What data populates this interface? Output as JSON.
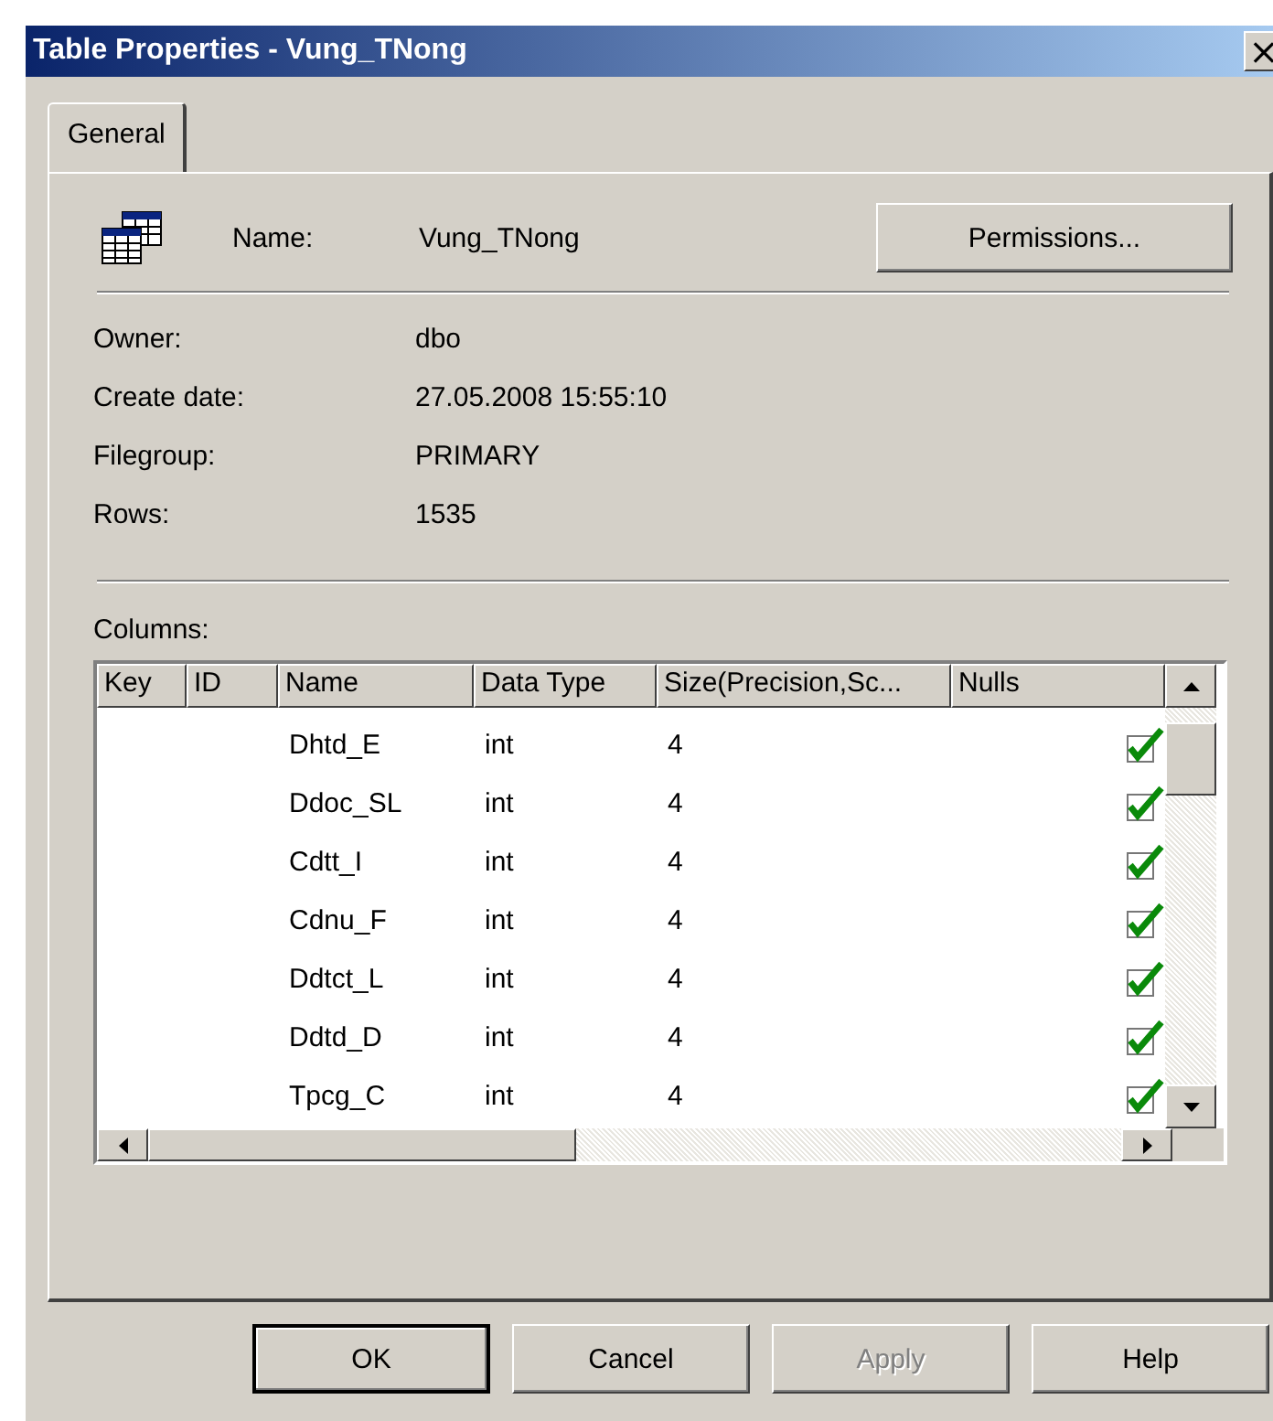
{
  "window": {
    "title": "Table Properties - Vung_TNong",
    "close": "×"
  },
  "tabs": [
    {
      "label": "General",
      "selected": true
    }
  ],
  "name": {
    "label": "Name:",
    "value": "Vung_TNong"
  },
  "permissions_button": "Permissions...",
  "properties": [
    {
      "label": "Owner:",
      "value": "dbo"
    },
    {
      "label": "Create date:",
      "value": "27.05.2008 15:55:10"
    },
    {
      "label": "Filegroup:",
      "value": "PRIMARY"
    },
    {
      "label": "Rows:",
      "value": "1535"
    }
  ],
  "columns_label": "Columns:",
  "table": {
    "columns": [
      "Key",
      "ID",
      "Name",
      "Data Type",
      "Size(Precision,Sc...",
      "Nulls"
    ],
    "rows": [
      {
        "name": "Dhtd_E",
        "type": "int",
        "size": "4",
        "nulls": true
      },
      {
        "name": "Ddoc_SL",
        "type": "int",
        "size": "4",
        "nulls": true
      },
      {
        "name": "Cdtt_I",
        "type": "int",
        "size": "4",
        "nulls": true
      },
      {
        "name": "Cdnu_F",
        "type": "int",
        "size": "4",
        "nulls": true
      },
      {
        "name": "Ddtct_L",
        "type": "int",
        "size": "4",
        "nulls": true
      },
      {
        "name": "Ddtd_D",
        "type": "int",
        "size": "4",
        "nulls": true
      },
      {
        "name": "Tpcg_C",
        "type": "int",
        "size": "4",
        "nulls": true
      }
    ]
  },
  "buttons": [
    {
      "label": "OK",
      "default": true,
      "disabled": false
    },
    {
      "label": "Cancel",
      "default": false,
      "disabled": false
    },
    {
      "label": "Apply",
      "default": false,
      "disabled": true
    },
    {
      "label": "Help",
      "default": false,
      "disabled": false
    }
  ]
}
